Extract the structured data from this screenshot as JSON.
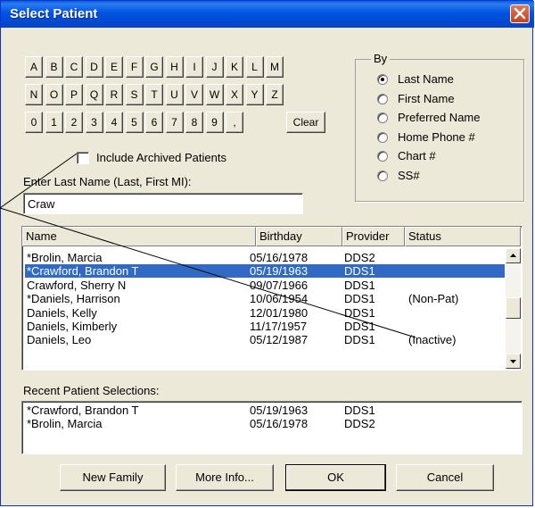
{
  "window": {
    "title": "Select Patient"
  },
  "keyboard": {
    "row1": [
      "A",
      "B",
      "C",
      "D",
      "E",
      "F",
      "G",
      "H",
      "I",
      "J",
      "K",
      "L",
      "M"
    ],
    "row2": [
      "N",
      "O",
      "P",
      "Q",
      "R",
      "S",
      "T",
      "U",
      "V",
      "W",
      "X",
      "Y",
      "Z"
    ],
    "row3": [
      "0",
      "1",
      "2",
      "3",
      "4",
      "5",
      "6",
      "7",
      "8",
      "9",
      ","
    ],
    "clear_label": "Clear"
  },
  "by": {
    "label": "By",
    "options": [
      "Last Name",
      "First Name",
      "Preferred Name",
      "Home Phone #",
      "Chart #",
      "SS#"
    ],
    "selected": "Last Name"
  },
  "archived": {
    "label": "Include Archived Patients",
    "checked": false
  },
  "search": {
    "label": "Enter Last Name (Last, First MI):",
    "value": "Craw"
  },
  "patients": {
    "headers": {
      "name": "Name",
      "birthday": "Birthday",
      "provider": "Provider",
      "status": "Status"
    },
    "rows": [
      {
        "name": "*Brolin, Marcia",
        "birthday": "05/16/1978",
        "provider": "DDS2",
        "status": ""
      },
      {
        "name": "*Crawford, Brandon T",
        "birthday": "05/19/1963",
        "provider": "DDS1",
        "status": "",
        "selected": true
      },
      {
        "name": "Crawford, Sherry N",
        "birthday": "09/07/1966",
        "provider": "DDS1",
        "status": ""
      },
      {
        "name": "*Daniels, Harrison",
        "birthday": "10/06/1954",
        "provider": "DDS1",
        "status": "(Non-Pat)"
      },
      {
        "name": "Daniels, Kelly",
        "birthday": "12/01/1980",
        "provider": "DDS1",
        "status": ""
      },
      {
        "name": "Daniels, Kimberly",
        "birthday": "11/17/1957",
        "provider": "DDS1",
        "status": ""
      },
      {
        "name": "Daniels, Leo",
        "birthday": "05/12/1987",
        "provider": "DDS1",
        "status": "(Inactive)"
      }
    ]
  },
  "recent": {
    "label": "Recent Patient Selections:",
    "rows": [
      {
        "name": "*Crawford, Brandon T",
        "birthday": "05/19/1963",
        "provider": "DDS1"
      },
      {
        "name": "*Brolin, Marcia",
        "birthday": "05/16/1978",
        "provider": "DDS2"
      }
    ]
  },
  "buttons": {
    "new_family": "New Family",
    "more_info": "More Info...",
    "ok": "OK",
    "cancel": "Cancel"
  },
  "colors": {
    "titlebar": "#0054e3",
    "selection": "#316ac5",
    "face": "#ece9d8",
    "close": "#d9532c"
  },
  "icons": {
    "close": "close-icon",
    "scroll_up": "arrow-up-icon",
    "scroll_down": "arrow-down-icon"
  }
}
